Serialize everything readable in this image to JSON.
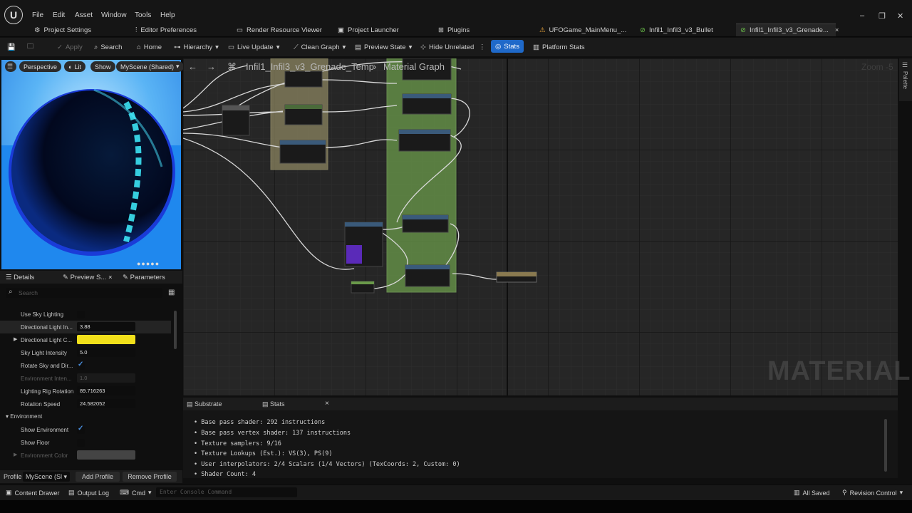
{
  "menus": [
    "File",
    "Edit",
    "Asset",
    "Window",
    "Tools",
    "Help"
  ],
  "editor_tabs": [
    "Project Settings",
    "Editor Preferences",
    "Render Resource Viewer",
    "Project Launcher",
    "Plugins",
    "UFOGame_MainMenu_...",
    "Infil1_Infil3_v3_Bullet",
    "Infil1_Infil3_v3_Grenade..."
  ],
  "toolbar": {
    "apply": "Apply",
    "search": "Search",
    "home": "Home",
    "hierarchy": "Hierarchy",
    "live_update": "Live Update",
    "clean_graph": "Clean Graph",
    "preview_state": "Preview State",
    "hide_unrelated": "Hide Unrelated",
    "stats": "Stats",
    "platform_stats": "Platform Stats"
  },
  "viewport": {
    "perspective": "Perspective",
    "lit": "Lit",
    "show": "Show",
    "scene": "MyScene (Shared)"
  },
  "details_tabs": {
    "details": "Details",
    "preview": "Preview S...",
    "parameters": "Parameters"
  },
  "search_placeholder": "Search",
  "properties": [
    {
      "label": "Use Sky Lighting",
      "type": "check",
      "checked": false
    },
    {
      "label": "Directional Light In...",
      "type": "value",
      "value": "3.88"
    },
    {
      "label": "Directional Light C...",
      "type": "color",
      "color": "#f2e01b"
    },
    {
      "label": "Sky Light Intensity",
      "type": "value",
      "value": "5.0"
    },
    {
      "label": "Rotate Sky and Dir...",
      "type": "check",
      "checked": true
    },
    {
      "label": "Environment Inten...",
      "type": "value",
      "value": "1.0",
      "dim": true
    },
    {
      "label": "Lighting Rig Rotation",
      "type": "value",
      "value": "89.716263"
    },
    {
      "label": "Rotation Speed",
      "type": "value",
      "value": "24.582052"
    }
  ],
  "environment": {
    "header": "Environment",
    "props": [
      {
        "label": "Show Environment",
        "checked": true
      },
      {
        "label": "Show Floor",
        "checked": false
      },
      {
        "label": "Environment Color"
      }
    ]
  },
  "profile": {
    "label": "Profile",
    "value": "MyScene (Sl",
    "add": "Add Profile",
    "remove": "Remove Profile"
  },
  "breadcrumb": {
    "asset": "Infil1_Infil3_v3_Grenade_Temp",
    "graph": "Material Graph"
  },
  "zoom": "Zoom -5",
  "palette": "Palette",
  "watermark": "MATERIAL",
  "bottom_tabs": {
    "substrate": "Substrate",
    "stats": "Stats"
  },
  "stats_lines": [
    "Base pass shader: 292 instructions",
    "Base pass vertex shader: 137 instructions",
    "Texture samplers: 9/16",
    "Texture Lookups (Est.): VS(3), PS(9)",
    "User interpolators: 2/4 Scalars (1/4 Vectors) (TexCoords: 2, Custom: 0)",
    "Shader Count: 4"
  ],
  "statusbar": {
    "content_drawer": "Content Drawer",
    "output_log": "Output Log",
    "cmd": "Cmd",
    "console_placeholder": "Enter Console Command",
    "all_saved": "All Saved",
    "revision": "Revision Control"
  },
  "colors": {
    "accent": "#1f69c9",
    "viewport_sky": "#3d9df0",
    "graph_bg": "#262626",
    "green_comment": "#6a9a4a",
    "tan_comment": "#8a8460"
  }
}
